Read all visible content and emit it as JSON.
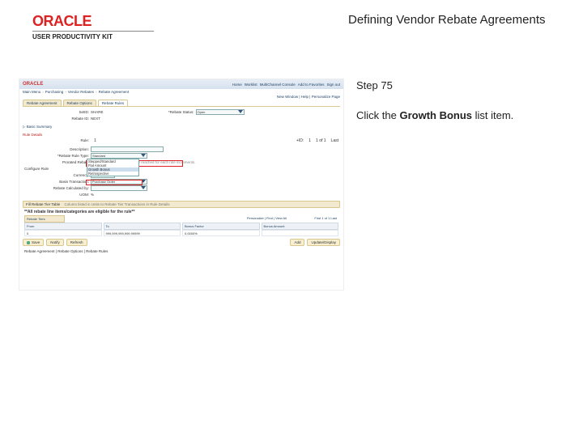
{
  "header": {
    "brand": "ORACLE",
    "brand_sub": "USER PRODUCTIVITY KIT",
    "page_title": "Defining Vendor Rebate Agreements"
  },
  "instruction": {
    "step_label": "Step 75",
    "text_prefix": "Click the ",
    "text_bold": "Growth Bonus",
    "text_suffix": " list item."
  },
  "shot": {
    "oracle": "ORACLE",
    "nav": [
      "Home",
      "Worklist",
      "MultiChannel Console",
      "Add to Favorites",
      "Sign out"
    ],
    "crumb": [
      "Main Menu",
      "Purchasing",
      "Vendor Rebates",
      "Rebate Agreement"
    ],
    "userline": "New Window | Help | Personalize Page",
    "tabs": [
      "Rebate Agreement",
      "Rebate Options",
      "Rebate Rules"
    ],
    "form": {
      "setid_l": "SetID:",
      "setid_v": "SHARE",
      "rebid_l": "Rebate ID:",
      "rebid_v": "NEXT",
      "rebstat_l": "*Rebate Status:",
      "rebstat_v": "Open",
      "basesum": "▷ Basic Summary",
      "rulehdr": "Rule Details",
      "rule_l": "Rule:",
      "rule_v": "1",
      "seq_l": "+ID:",
      "seq_v": "1",
      "one_l": "1 of 1",
      "last_l": "Last",
      "desc_l": "Description:",
      "rtype_l": "*Rebate Rule Type:",
      "rtype_v": "Standard",
      "opt_stepped": "Stepped/Standard",
      "opt_retro": "Flat Amount",
      "opt_growth": "Growth Bonus",
      "opt_market": "Retrospective",
      "protext": "Prorated Rebate",
      "prohint": "Subcomponents must be met / reached for each rule increments.",
      "conf": "Configure Rule",
      "cur_l": "Currency:",
      "cur_v": "EUR",
      "bt_l": "Basis Transaction:",
      "bt_v": "Purchase Order",
      "rc_l": "Rebate Calculated by:",
      "uom_l": "UOM:",
      "uom_v": "%",
      "fill_bar": "Fill Rebate Tier Table",
      "fill_hint": "Column listed in Units to Rebate Tier Transactions in Rule Details",
      "elig": "**All rebate line items/categories are eligible for the rule**",
      "grid_tab1": "Rebate Tiers",
      "grid_c1": "From",
      "grid_c2": "To",
      "grid_c3": "Bonus Factor",
      "grid_c4": "Bonus Amount",
      "grid_cust": "Personalize | Find | View All",
      "grid_nav": "First 1 of 1 Last",
      "grid_v1": "0",
      "grid_v2": "999,999,999,999.99999",
      "grid_v3": "0.0000%",
      "b_save": "Save",
      "b_notify": "Notify",
      "b_refresh": "Refresh",
      "b_add": "Add",
      "b_update": "Update/Display",
      "foot": "Rebate Agreement | Rebate Options | Rebate Rules"
    }
  }
}
